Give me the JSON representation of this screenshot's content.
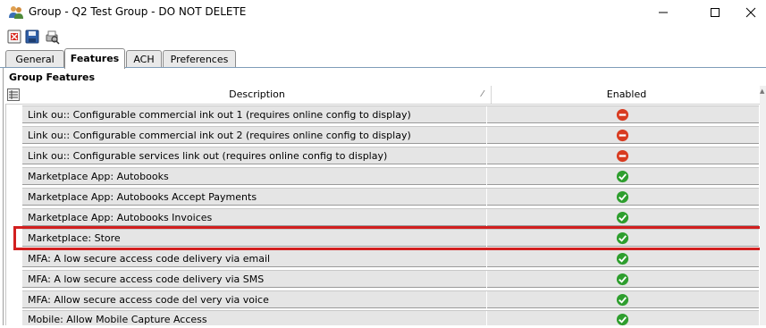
{
  "window": {
    "title": "Group - Q2 Test Group - DO NOT DELETE",
    "app_icon": "users-icon",
    "controls": [
      "minimize",
      "maximize",
      "close"
    ]
  },
  "toolbar": {
    "buttons": [
      {
        "name": "delete",
        "icon": "delete-icon"
      },
      {
        "name": "save",
        "icon": "save-icon"
      },
      {
        "name": "print-preview",
        "icon": "print-preview-icon"
      }
    ]
  },
  "tabs": [
    {
      "label": "General",
      "active": false
    },
    {
      "label": "Features",
      "active": true
    },
    {
      "label": "ACH",
      "active": false
    },
    {
      "label": "Preferences",
      "active": false
    }
  ],
  "group_features": {
    "title": "Group Features",
    "columns": {
      "description": "Description",
      "enabled": "Enabled"
    },
    "rows": [
      {
        "description": "Link ou:: Configurable commercial ink out 1 (requires online config to display)",
        "enabled": false
      },
      {
        "description": "Link ou:: Configurable commercial ink out 2 (requires online config to display)",
        "enabled": false
      },
      {
        "description": "Link ou:: Configurable services link out (requires online config to display)",
        "enabled": false
      },
      {
        "description": "Marketplace App: Autobooks",
        "enabled": true
      },
      {
        "description": "Marketplace App: Autobooks Accept Payments",
        "enabled": true
      },
      {
        "description": "Marketplace App: Autobooks Invoices",
        "enabled": true
      },
      {
        "description": "Marketplace: Store",
        "enabled": true,
        "highlighted": true
      },
      {
        "description": "MFA: A low secure access code delivery via email",
        "enabled": true
      },
      {
        "description": "MFA: A low secure access code delivery via SMS",
        "enabled": true
      },
      {
        "description": "MFA: Allow secure access code del very via voice",
        "enabled": true
      },
      {
        "description": "Mobile: Allow Mobile Capture Access",
        "enabled": true
      }
    ]
  },
  "colors": {
    "highlight": "#d21f1f",
    "enabled": "#2e9e2e",
    "disabled": "#d83b20",
    "row_bg": "#e5e5e5"
  }
}
